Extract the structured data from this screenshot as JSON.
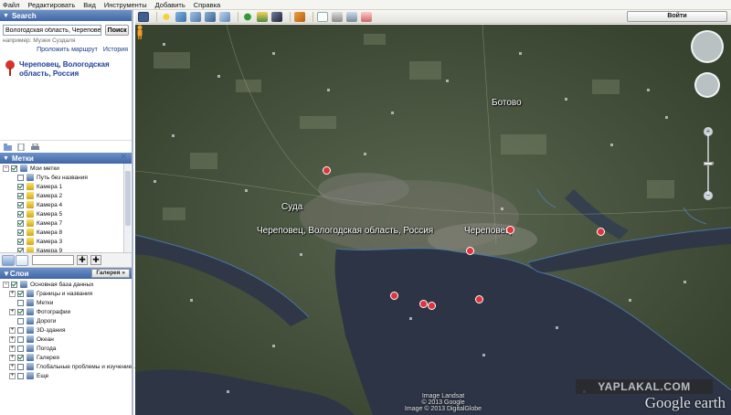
{
  "menu": [
    "Файл",
    "Редактировать",
    "Вид",
    "Инструменты",
    "Добавить",
    "Справка"
  ],
  "search": {
    "header": "Search",
    "query": "Вологодская область, Череповец",
    "button": "Поиск",
    "example": "например: Музеи Суздаля",
    "route_link": "Проложить маршрут",
    "history_link": "История",
    "result": "Череповец, Вологодская область, Россия"
  },
  "places": {
    "header": "Метки",
    "items": [
      {
        "label": "Мои метки",
        "checked": true,
        "indent": 0,
        "expand": "−"
      },
      {
        "label": "Путь без названия",
        "checked": false,
        "indent": 1
      },
      {
        "label": "Камера 1",
        "checked": true,
        "indent": 1
      },
      {
        "label": "Камера 2",
        "checked": true,
        "indent": 1
      },
      {
        "label": "Камера 4",
        "checked": true,
        "indent": 1
      },
      {
        "label": "Камера 5",
        "checked": true,
        "indent": 1
      },
      {
        "label": "Камера 7",
        "checked": true,
        "indent": 1
      },
      {
        "label": "Камера 8",
        "checked": true,
        "indent": 1
      },
      {
        "label": "Камера 3",
        "checked": true,
        "indent": 1
      },
      {
        "label": "Камера 9",
        "checked": true,
        "indent": 1
      },
      {
        "label": "Камера 6",
        "checked": true,
        "indent": 1
      }
    ]
  },
  "layers": {
    "header": "Слои",
    "gallery_button": "Галерея »",
    "items": [
      {
        "label": "Основная база данных",
        "checked": true,
        "indent": 0,
        "expand": "−"
      },
      {
        "label": "Границы и названия",
        "checked": true,
        "indent": 1,
        "expand": "+"
      },
      {
        "label": "Метки",
        "checked": false,
        "indent": 1
      },
      {
        "label": "Фотографии",
        "checked": true,
        "indent": 1,
        "expand": "+"
      },
      {
        "label": "Дороги",
        "checked": false,
        "indent": 1
      },
      {
        "label": "3D-здания",
        "checked": false,
        "indent": 1,
        "expand": "+"
      },
      {
        "label": "Океан",
        "checked": false,
        "indent": 1,
        "expand": "+"
      },
      {
        "label": "Погода",
        "checked": false,
        "indent": 1,
        "expand": "+"
      },
      {
        "label": "Галерея",
        "checked": true,
        "indent": 1,
        "expand": "+"
      },
      {
        "label": "Глобальные проблемы и изучение ...",
        "checked": false,
        "indent": 1,
        "expand": "+"
      },
      {
        "label": "Еще",
        "checked": false,
        "indent": 1,
        "expand": "+"
      }
    ]
  },
  "toolbar": {
    "signin": "Войти"
  },
  "map": {
    "labels": {
      "botovo": "Ботово",
      "suda": "Суда",
      "city": "Череповец, Вологодская область, Россия",
      "cherepovets": "Череповец"
    },
    "credit_line1": "Image Landsat",
    "credit_line2": "© 2013 Google",
    "credit_line3": "Image © 2013 DigitalGlobe",
    "watermark": "YAPLAKAL.COM",
    "brand": "Google earth"
  },
  "colors": {
    "panel_header": "#4a70ad",
    "link": "#1a3f8a",
    "water": "#2c3445",
    "land": "#4f5a48",
    "poi": "#e0333a"
  }
}
